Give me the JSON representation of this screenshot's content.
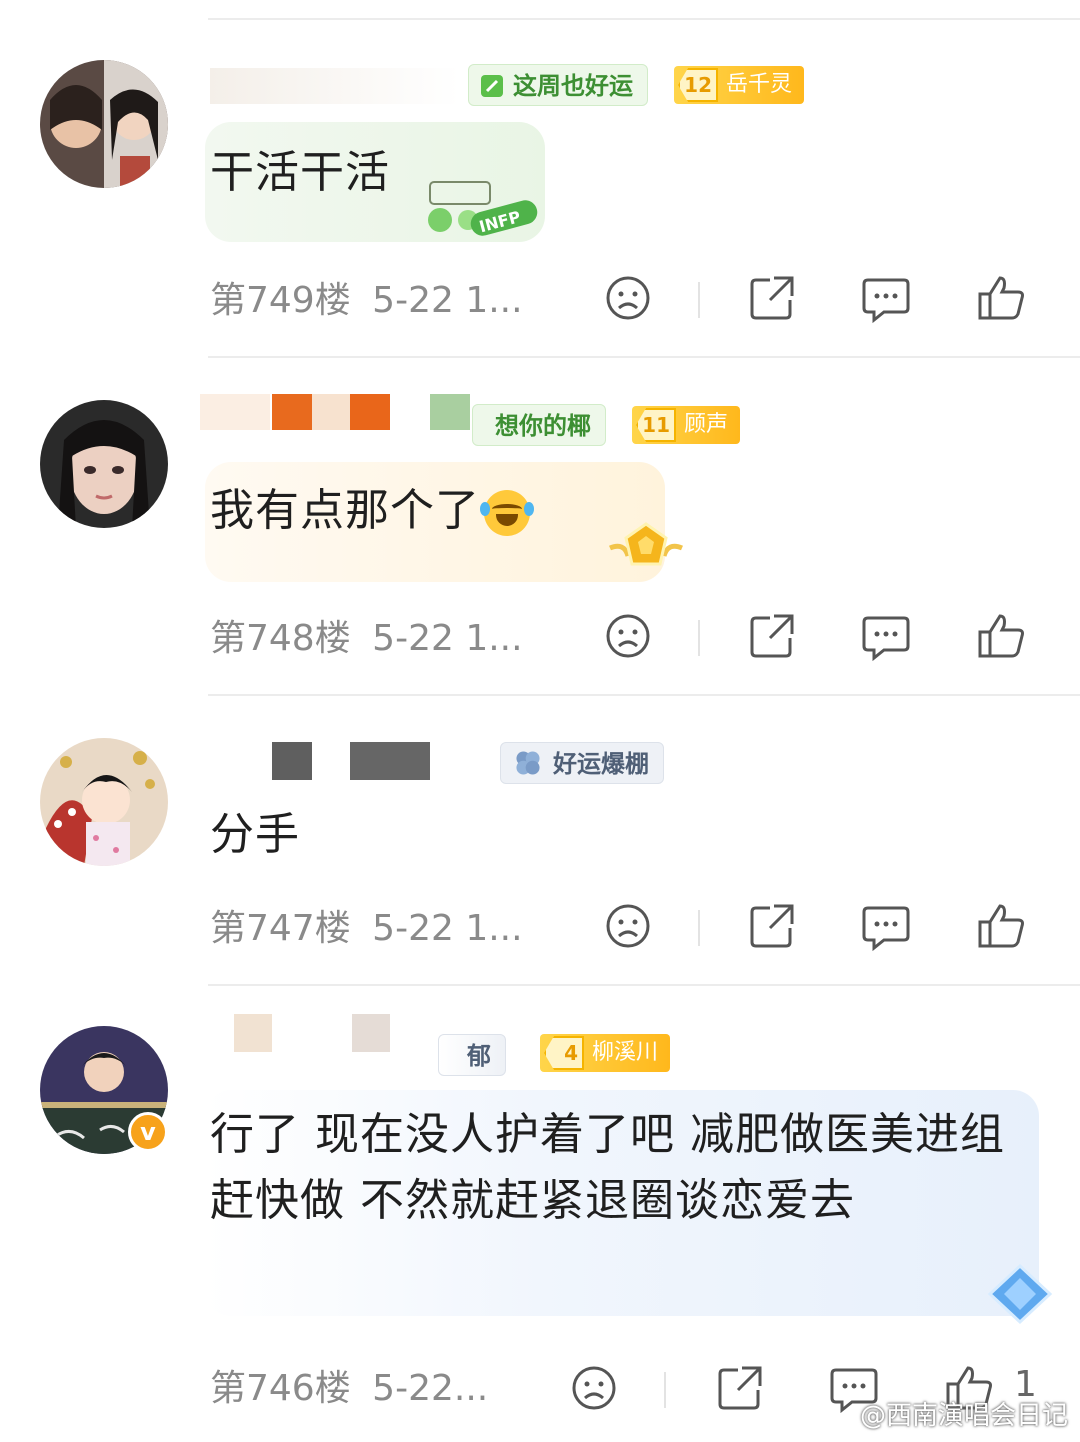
{
  "comments": [
    {
      "text": "干活干活",
      "floor": "第749楼",
      "time": "5-22 1...",
      "badge": "这周也好运",
      "fan_level": "12",
      "fan_name": "岳千灵",
      "bubble_decoration": "INFP"
    },
    {
      "text": "我有点那个了",
      "floor": "第748楼",
      "time": "5-22 1...",
      "badge": "想你的椰",
      "fan_level": "11",
      "fan_name": "顾声"
    },
    {
      "text": "分手",
      "floor": "第747楼",
      "time": "5-22 1...",
      "badge": "好运爆棚"
    },
    {
      "text": "行了 现在没人护着了吧 减肥做医美进组赶快做 不然就赶紧退圈谈恋爱去",
      "floor": "第746楼",
      "time": "5-22...",
      "badge": "郁",
      "fan_level": "4",
      "fan_name": "柳溪川",
      "verified_mark": "v",
      "like_count": "1"
    }
  ],
  "watermark": "@西南演唱会日记",
  "icons": [
    "sad-face-icon",
    "share-icon",
    "comment-icon",
    "thumbs-up-icon"
  ],
  "colors": {
    "accent_green": "#3d8f33",
    "fan_gold": "#ffb81c",
    "meta_grey": "#8a8a8a"
  }
}
